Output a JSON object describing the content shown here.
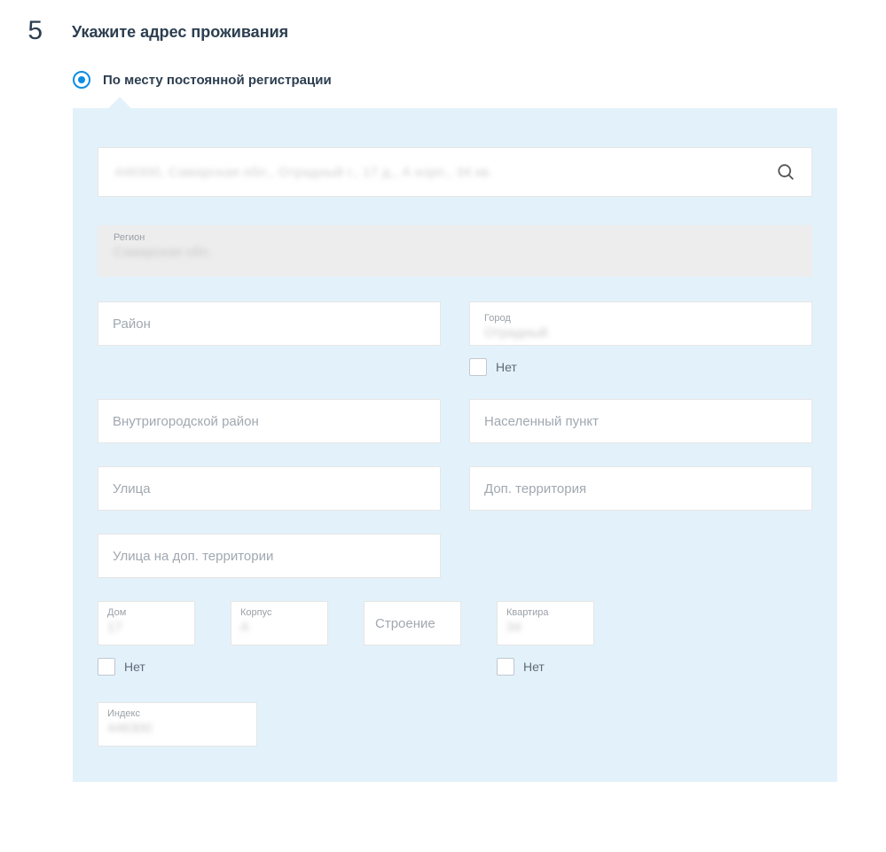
{
  "step": {
    "number": "5",
    "title": "Укажите адрес проживания"
  },
  "radio": {
    "label": "По месту постоянной регистрации"
  },
  "search": {
    "blurred_value": "446300, Самарская обл., Отрадный г., 17 д., А корп., 34 кв."
  },
  "region": {
    "label": "Регион",
    "blurred_value": "Самарская обл."
  },
  "district": {
    "placeholder": "Район"
  },
  "city": {
    "label": "Город",
    "blurred_value": "Отрадный",
    "no_label": "Нет"
  },
  "inner_district": {
    "placeholder": "Внутригородской район"
  },
  "settlement": {
    "placeholder": "Населенный пункт"
  },
  "street": {
    "placeholder": "Улица"
  },
  "extra_territory": {
    "placeholder": "Доп. территория"
  },
  "street_extra": {
    "placeholder": "Улица на доп. территории"
  },
  "house": {
    "label": "Дом",
    "blurred_value": "17",
    "no_label": "Нет"
  },
  "building_part": {
    "label": "Корпус",
    "blurred_value": "А"
  },
  "structure": {
    "placeholder": "Строение"
  },
  "apartment": {
    "label": "Квартира",
    "blurred_value": "34",
    "no_label": "Нет"
  },
  "postcode": {
    "label": "Индекс",
    "blurred_value": "446300"
  }
}
